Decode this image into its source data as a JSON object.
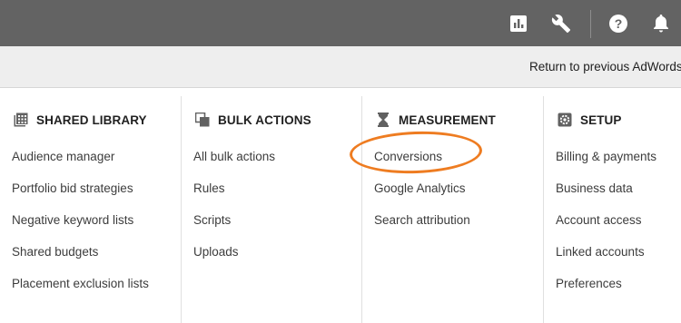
{
  "topbar": {
    "icons": [
      "reports-icon",
      "tools-wrench-icon",
      "help-icon",
      "notifications-bell-icon"
    ]
  },
  "subbar": {
    "return_label": "Return to previous AdWords"
  },
  "columns": [
    {
      "title": "SHARED LIBRARY",
      "icon": "library-grid-icon",
      "items": [
        "Audience manager",
        "Portfolio bid strategies",
        "Negative keyword lists",
        "Shared budgets",
        "Placement exclusion lists"
      ]
    },
    {
      "title": "BULK ACTIONS",
      "icon": "bulk-copy-icon",
      "items": [
        "All bulk actions",
        "Rules",
        "Scripts",
        "Uploads"
      ]
    },
    {
      "title": "MEASUREMENT",
      "icon": "hourglass-icon",
      "items": [
        "Conversions",
        "Google Analytics",
        "Search attribution"
      ]
    },
    {
      "title": "SETUP",
      "icon": "gear-icon",
      "items": [
        "Billing & payments",
        "Business data",
        "Account access",
        "Linked accounts",
        "Preferences"
      ]
    }
  ],
  "annotation": {
    "color": "#ee7c21",
    "target": "Conversions"
  }
}
